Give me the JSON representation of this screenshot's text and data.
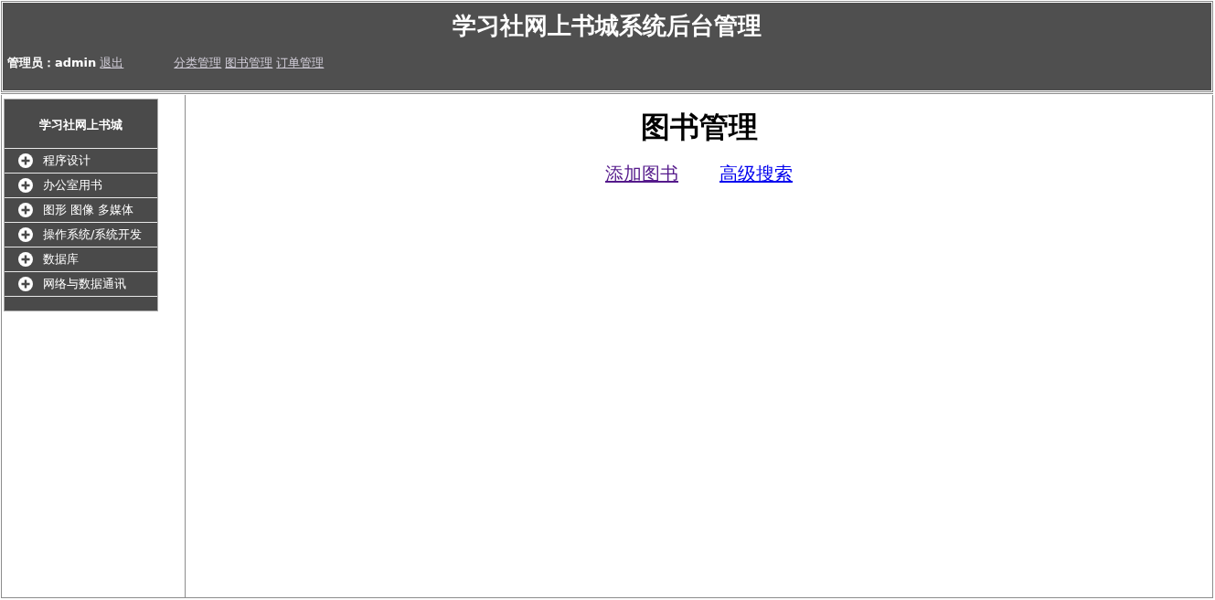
{
  "header": {
    "title": "学习社网上书城系统后台管理",
    "admin_label": "管理员：admin",
    "logout": "退出",
    "nav_links": [
      {
        "label": "分类管理"
      },
      {
        "label": "图书管理"
      },
      {
        "label": "订单管理"
      }
    ]
  },
  "sidebar": {
    "title": "学习社网上书城",
    "items": [
      {
        "label": "程序设计"
      },
      {
        "label": "办公室用书"
      },
      {
        "label": "图形 图像 多媒体"
      },
      {
        "label": "操作系统/系统开发"
      },
      {
        "label": "数据库"
      },
      {
        "label": "网络与数据通讯"
      }
    ]
  },
  "main": {
    "heading": "图书管理",
    "links": [
      {
        "label": "添加图书",
        "visited": true
      },
      {
        "label": "高级搜索",
        "visited": false
      }
    ]
  }
}
